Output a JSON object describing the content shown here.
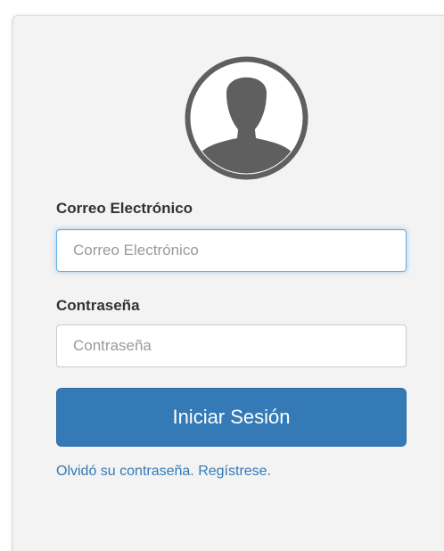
{
  "form": {
    "email_label": "Correo Electrónico",
    "email_placeholder": "Correo Electrónico",
    "email_value": "",
    "password_label": "Contraseña",
    "password_placeholder": "Contraseña",
    "password_value": "",
    "submit_label": "Iniciar Sesión"
  },
  "links": {
    "forgot_password": "Olvidó su contraseña.",
    "register": "Regístrese."
  },
  "avatar": {
    "icon": "user-silhouette-icon"
  },
  "colors": {
    "primary": "#337ab7",
    "focus_border": "#66afe9",
    "card_background": "#f3f3f3",
    "avatar_fill": "#5f5f5f"
  }
}
